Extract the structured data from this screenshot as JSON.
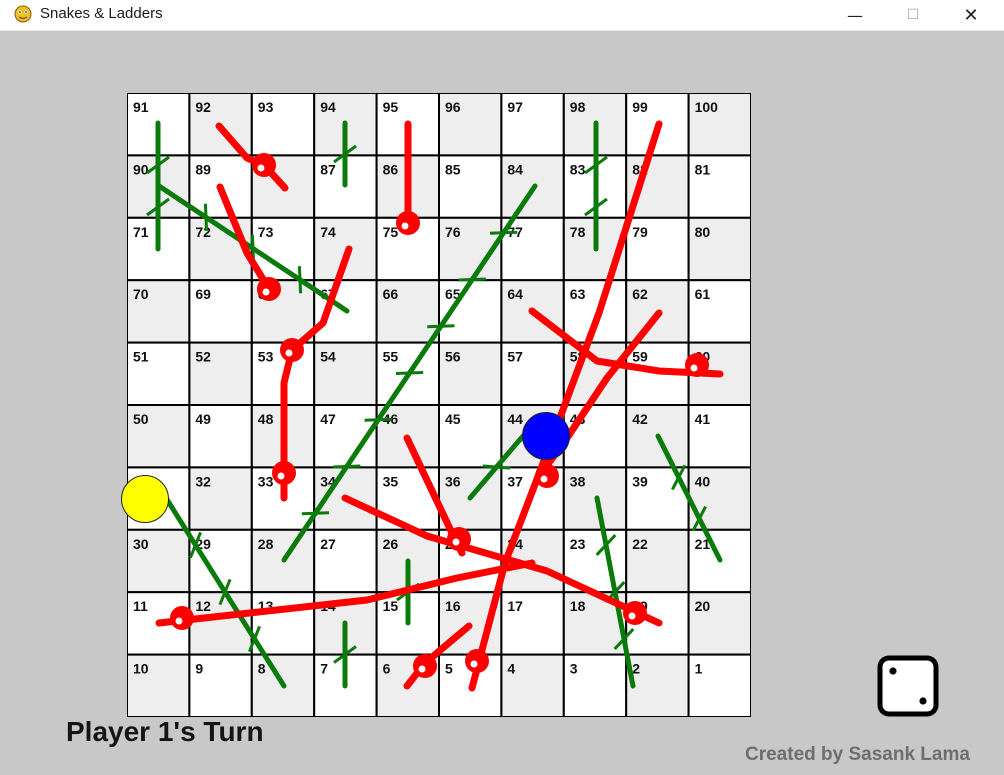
{
  "window": {
    "title": "Snakes & Ladders",
    "icon": "python-snake-icon",
    "controls": [
      "minimize",
      "maximize",
      "close"
    ],
    "control_glyphs": {
      "minimize": "—",
      "maximize": "☐",
      "close": "✕"
    }
  },
  "board": {
    "rows": [
      [
        91,
        92,
        93,
        94,
        95,
        96,
        97,
        98,
        99,
        100
      ],
      [
        90,
        89,
        88,
        87,
        86,
        85,
        84,
        83,
        82,
        81
      ],
      [
        71,
        72,
        73,
        74,
        75,
        76,
        77,
        78,
        79,
        80
      ],
      [
        70,
        69,
        68,
        67,
        66,
        65,
        64,
        63,
        62,
        61
      ],
      [
        51,
        52,
        53,
        54,
        55,
        56,
        57,
        58,
        59,
        60
      ],
      [
        50,
        49,
        48,
        47,
        46,
        45,
        44,
        43,
        42,
        41
      ],
      [
        31,
        32,
        33,
        34,
        35,
        36,
        37,
        38,
        39,
        40
      ],
      [
        30,
        29,
        28,
        27,
        26,
        25,
        24,
        23,
        22,
        21
      ],
      [
        11,
        12,
        13,
        14,
        15,
        16,
        17,
        18,
        19,
        20
      ],
      [
        10,
        9,
        8,
        7,
        6,
        5,
        4,
        3,
        2,
        1
      ]
    ],
    "colors": {
      "light_cell": "#ffffff",
      "dark_cell": "#eeeeee",
      "grid": "#000000",
      "ladder": "#0a7a0a",
      "snake": "#ff0000"
    },
    "ladders": [
      {
        "from": 71,
        "to": 90
      },
      {
        "from": 52,
        "to": 67
      },
      {
        "from": 27,
        "to": 84
      },
      {
        "from": 78,
        "to": 83
      },
      {
        "from": 2,
        "to": 22
      },
      {
        "from": 21,
        "to": 42
      },
      {
        "from": 37,
        "to": 44
      },
      {
        "from": 15,
        "to": 15
      },
      {
        "from": 7,
        "to": 7
      },
      {
        "from": 87,
        "to": 87
      },
      {
        "from": 8,
        "to": 30
      }
    ],
    "snakes": [
      {
        "head": 88,
        "tail": 93
      },
      {
        "head": 86,
        "tail": 95
      },
      {
        "head": 68,
        "tail": 89
      },
      {
        "head": 53,
        "tail": 67
      },
      {
        "head": 33,
        "tail": 53
      },
      {
        "head": 12,
        "tail": 24
      },
      {
        "head": 4,
        "tail": 99
      },
      {
        "head": 37,
        "tail": 59
      },
      {
        "head": 25,
        "tail": 46
      },
      {
        "head": 19,
        "tail": 34
      },
      {
        "head": 6,
        "tail": 5
      },
      {
        "head": 60,
        "tail": 63
      }
    ]
  },
  "players": [
    {
      "name": "Player 1",
      "color": "#ffff00",
      "position": 30
    },
    {
      "name": "Player 2",
      "color": "#0000ff",
      "position": 44
    }
  ],
  "status": {
    "turn_text": "Player 1's Turn",
    "credit_text": "Created by Sasank Lama"
  },
  "dice": {
    "value": 2,
    "icon": "dice-two-icon"
  }
}
